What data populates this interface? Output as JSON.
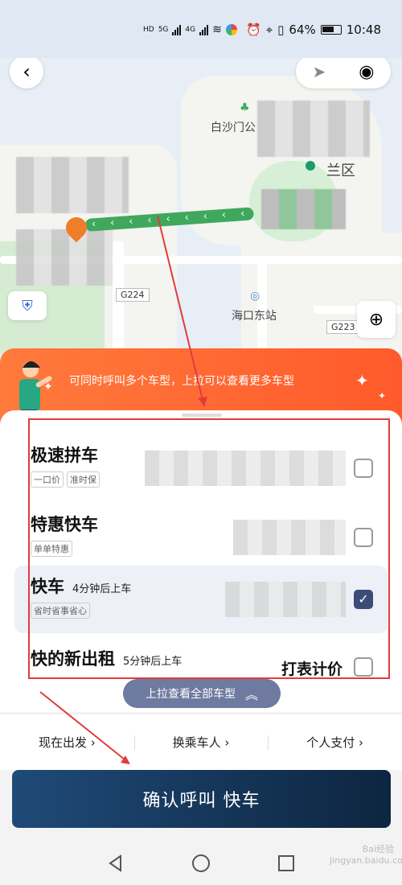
{
  "status_bar": {
    "left_indicators": [
      "HD",
      "5G",
      "4G"
    ],
    "battery": "64%",
    "time": "10:48"
  },
  "map": {
    "labels": {
      "baisha": "白沙门公",
      "district": "兰区",
      "station": "海口东站"
    },
    "road_badges": [
      "G224",
      "G223"
    ],
    "route_color": "#3fa85c",
    "pin_color": "#f07d2a"
  },
  "banner": {
    "text": "可同时呼叫多个车型，上拉可以查看更多车型",
    "color": "#ff6a32"
  },
  "cars": [
    {
      "name": "极速拼车",
      "eta": "",
      "tags": [
        "一口价",
        "准时保"
      ],
      "selected": false,
      "right_text": ""
    },
    {
      "name": "特惠快车",
      "eta": "",
      "tags": [
        "单单特惠"
      ],
      "selected": false,
      "right_text": ""
    },
    {
      "name": "快车",
      "eta": "4分钟后上车",
      "tags": [
        "省时省事省心"
      ],
      "selected": true,
      "right_text": ""
    },
    {
      "name": "快的新出租",
      "eta": "5分钟后上车",
      "tags": [],
      "selected": false,
      "right_text": "打表计价"
    }
  ],
  "pull_up": "上拉查看全部车型",
  "options": [
    "现在出发 ›",
    "换乘车人 ›",
    "个人支付 ›"
  ],
  "confirm": "确认呼叫 快车",
  "accent_color": "#1f4a78",
  "annotation_color": "#e23b3b",
  "watermark": "Bai经验 jingyan.baidu.com"
}
